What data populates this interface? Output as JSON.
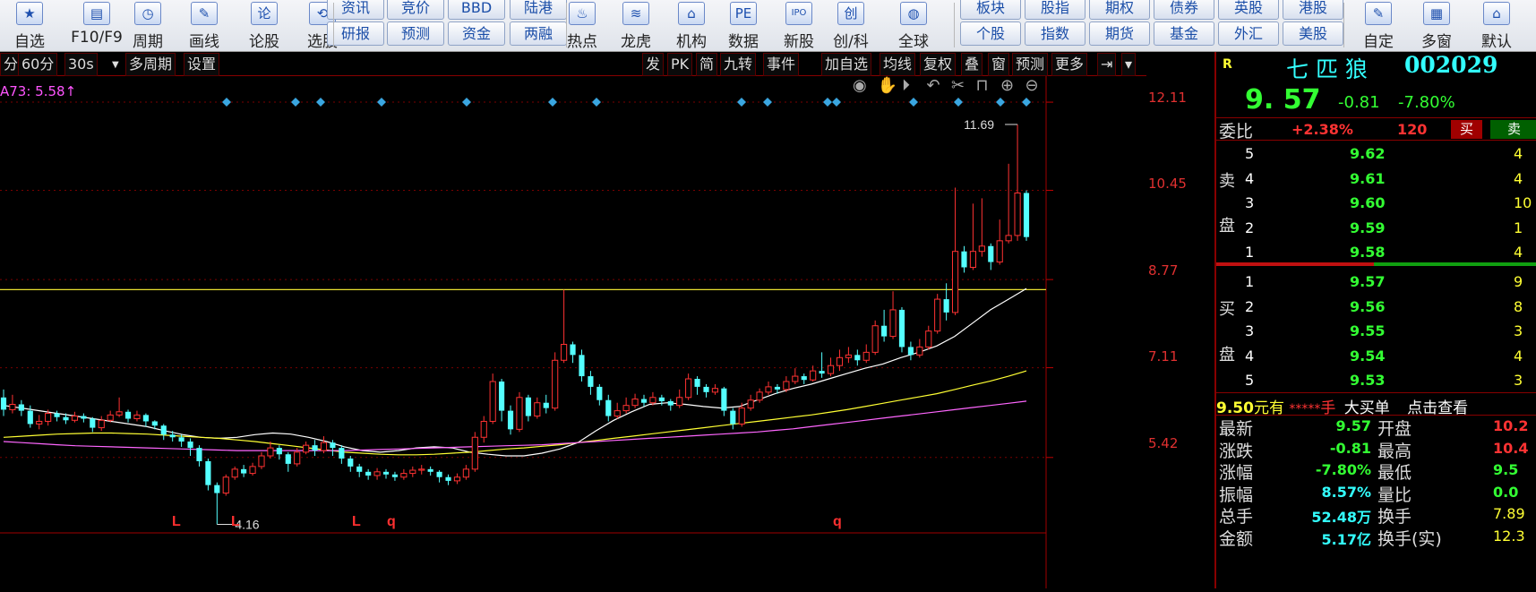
{
  "toolbar": {
    "icon_buttons": [
      {
        "label": "自选",
        "icon": "star-icon",
        "glyph": "★"
      },
      {
        "label": "F10/F9",
        "icon": "f10-icon",
        "glyph": "▤"
      },
      {
        "label": "周期",
        "icon": "clock-icon",
        "glyph": "◷"
      },
      {
        "label": "画线",
        "icon": "pencil-icon",
        "glyph": "✎"
      },
      {
        "label": "论股",
        "icon": "discuss-icon",
        "glyph": "论"
      },
      {
        "label": "选股",
        "icon": "pick-stock-icon",
        "glyph": "⟲"
      }
    ],
    "pills_top": [
      "资讯",
      "竞价",
      "BBD",
      "陆港"
    ],
    "pills_bottom": [
      "研报",
      "预测",
      "资金",
      "两融"
    ],
    "icon_buttons2": [
      {
        "label": "热点",
        "icon": "hot-icon",
        "glyph": "♨"
      },
      {
        "label": "龙虎",
        "icon": "dragon-icon",
        "glyph": "≋"
      },
      {
        "label": "机构",
        "icon": "bank-icon",
        "glyph": "⌂"
      },
      {
        "label": "数据",
        "icon": "pe-icon",
        "glyph": "PE"
      },
      {
        "label": "新股",
        "icon": "ipo-icon",
        "glyph": "IPO"
      },
      {
        "label": "创/科",
        "icon": "chuang-icon",
        "glyph": "创"
      },
      {
        "label": "全球",
        "icon": "globe-icon",
        "glyph": "◍"
      }
    ],
    "pills2_top": [
      "板块",
      "股指",
      "期权",
      "债券",
      "英股",
      "港股"
    ],
    "pills2_bottom": [
      "个股",
      "指数",
      "期货",
      "基金",
      "外汇",
      "美股"
    ],
    "icon_buttons3": [
      {
        "label": "自定",
        "icon": "custom-icon",
        "glyph": "✎"
      },
      {
        "label": "多窗",
        "icon": "multiwindow-icon",
        "glyph": "▦"
      },
      {
        "label": "默认",
        "icon": "home-icon",
        "glyph": "⌂"
      }
    ]
  },
  "chart_toolbar": {
    "left": [
      "分",
      "60分",
      "30s",
      "多周期",
      "设置"
    ],
    "right": [
      "发",
      "PK",
      "简",
      "九转",
      "事件",
      "加自选",
      "均线",
      "复权",
      "叠",
      "窗",
      "预测",
      "更多"
    ]
  },
  "chart": {
    "ma_label": "A73: 5.58↑",
    "y_ticks": [
      "12.11",
      "10.45",
      "8.77",
      "7.11",
      "5.42"
    ],
    "high_label": "11.69",
    "low_label": "4.16",
    "bottom_marks": [
      "L",
      "L",
      "L",
      "q",
      "q"
    ]
  },
  "chart_data": {
    "type": "candlestick",
    "ylim": [
      4.0,
      12.6
    ],
    "y_ticks": [
      12.11,
      10.45,
      8.77,
      7.11,
      5.42
    ],
    "highlight_level": 8.58,
    "high_marker": 11.69,
    "low_marker": 4.16,
    "candles": [
      [
        6.55,
        6.32,
        6.7,
        6.2
      ],
      [
        6.32,
        6.42,
        6.6,
        6.25
      ],
      [
        6.42,
        6.3,
        6.5,
        6.2
      ],
      [
        6.3,
        6.05,
        6.4,
        5.98
      ],
      [
        6.05,
        6.1,
        6.22,
        5.95
      ],
      [
        6.1,
        6.25,
        6.32,
        6.02
      ],
      [
        6.25,
        6.18,
        6.3,
        6.1
      ],
      [
        6.18,
        6.12,
        6.25,
        6.05
      ],
      [
        6.12,
        6.2,
        6.28,
        6.08
      ],
      [
        6.2,
        6.15,
        6.25,
        6.08
      ],
      [
        6.15,
        5.98,
        6.18,
        5.9
      ],
      [
        5.98,
        6.12,
        6.2,
        5.92
      ],
      [
        6.12,
        6.22,
        6.3,
        6.08
      ],
      [
        6.22,
        6.28,
        6.55,
        6.18
      ],
      [
        6.28,
        6.15,
        6.32,
        6.08
      ],
      [
        6.15,
        6.22,
        6.3,
        6.1
      ],
      [
        6.22,
        6.1,
        6.25,
        6.0
      ],
      [
        6.1,
        6.02,
        6.12,
        5.95
      ],
      [
        6.02,
        5.85,
        6.05,
        5.75
      ],
      [
        5.85,
        5.8,
        5.92,
        5.72
      ],
      [
        5.8,
        5.72,
        5.85,
        5.62
      ],
      [
        5.72,
        5.6,
        5.78,
        5.45
      ],
      [
        5.6,
        5.35,
        5.65,
        5.25
      ],
      [
        5.35,
        4.9,
        5.4,
        4.8
      ],
      [
        4.9,
        4.75,
        4.95,
        4.16
      ],
      [
        4.75,
        5.05,
        5.1,
        4.7
      ],
      [
        5.05,
        5.2,
        5.25,
        5.0
      ],
      [
        5.2,
        5.12,
        5.28,
        5.05
      ],
      [
        5.12,
        5.25,
        5.32,
        5.08
      ],
      [
        5.25,
        5.45,
        5.52,
        5.2
      ],
      [
        5.45,
        5.6,
        5.72,
        5.4
      ],
      [
        5.6,
        5.48,
        5.65,
        5.38
      ],
      [
        5.48,
        5.3,
        5.52,
        5.15
      ],
      [
        5.3,
        5.52,
        5.6,
        5.25
      ],
      [
        5.52,
        5.65,
        5.72,
        5.48
      ],
      [
        5.65,
        5.55,
        5.75,
        5.45
      ],
      [
        5.55,
        5.7,
        5.82,
        5.5
      ],
      [
        5.7,
        5.6,
        5.75,
        5.45
      ],
      [
        5.6,
        5.4,
        5.65,
        5.3
      ],
      [
        5.4,
        5.25,
        5.45,
        5.15
      ],
      [
        5.25,
        5.15,
        5.3,
        5.05
      ],
      [
        5.15,
        5.08,
        5.2,
        5.0
      ],
      [
        5.08,
        5.15,
        5.22,
        5.0
      ],
      [
        5.15,
        5.1,
        5.2,
        5.02
      ],
      [
        5.1,
        5.05,
        5.15,
        4.98
      ],
      [
        5.05,
        5.12,
        5.2,
        5.0
      ],
      [
        5.12,
        5.18,
        5.25,
        5.05
      ],
      [
        5.18,
        5.2,
        5.28,
        5.1
      ],
      [
        5.2,
        5.15,
        5.25,
        5.08
      ],
      [
        5.15,
        5.05,
        5.18,
        4.95
      ],
      [
        5.05,
        4.98,
        5.1,
        4.9
      ],
      [
        4.98,
        5.05,
        5.12,
        4.92
      ],
      [
        5.05,
        5.2,
        5.28,
        5.0
      ],
      [
        5.2,
        5.8,
        5.9,
        5.15
      ],
      [
        5.8,
        6.1,
        6.2,
        5.7
      ],
      [
        6.1,
        6.85,
        7.0,
        6.05
      ],
      [
        6.85,
        6.3,
        6.9,
        6.1
      ],
      [
        6.3,
        5.95,
        6.4,
        5.85
      ],
      [
        5.95,
        6.55,
        6.65,
        5.9
      ],
      [
        6.55,
        6.2,
        6.6,
        6.1
      ],
      [
        6.2,
        6.45,
        6.55,
        6.15
      ],
      [
        6.45,
        6.35,
        6.6,
        6.25
      ],
      [
        6.35,
        7.25,
        7.4,
        6.3
      ],
      [
        7.25,
        7.55,
        8.58,
        7.2
      ],
      [
        7.55,
        7.35,
        7.6,
        7.2
      ],
      [
        7.35,
        6.95,
        7.45,
        6.85
      ],
      [
        6.95,
        6.75,
        7.05,
        6.6
      ],
      [
        6.75,
        6.5,
        6.8,
        6.4
      ],
      [
        6.5,
        6.2,
        6.6,
        6.1
      ],
      [
        6.2,
        6.3,
        6.45,
        6.15
      ],
      [
        6.3,
        6.4,
        6.55,
        6.25
      ],
      [
        6.4,
        6.52,
        6.62,
        6.35
      ],
      [
        6.52,
        6.45,
        6.6,
        6.38
      ],
      [
        6.45,
        6.55,
        6.65,
        6.4
      ],
      [
        6.55,
        6.48,
        6.6,
        6.4
      ],
      [
        6.48,
        6.4,
        6.52,
        6.3
      ],
      [
        6.4,
        6.55,
        6.7,
        6.35
      ],
      [
        6.55,
        6.9,
        7.0,
        6.5
      ],
      [
        6.9,
        6.75,
        6.95,
        6.6
      ],
      [
        6.75,
        6.65,
        6.8,
        6.55
      ],
      [
        6.65,
        6.72,
        6.8,
        6.6
      ],
      [
        6.72,
        6.3,
        6.75,
        6.2
      ],
      [
        6.3,
        6.05,
        6.35,
        5.95
      ],
      [
        6.05,
        6.35,
        6.45,
        6.0
      ],
      [
        6.35,
        6.5,
        6.6,
        6.3
      ],
      [
        6.5,
        6.65,
        6.72,
        6.45
      ],
      [
        6.65,
        6.75,
        6.85,
        6.6
      ],
      [
        6.75,
        6.7,
        6.8,
        6.62
      ],
      [
        6.7,
        6.85,
        6.95,
        6.65
      ],
      [
        6.85,
        6.95,
        7.1,
        6.8
      ],
      [
        6.95,
        6.88,
        7.0,
        6.8
      ],
      [
        6.88,
        7.05,
        7.15,
        6.85
      ],
      [
        7.05,
        7.0,
        7.4,
        6.92
      ],
      [
        7.0,
        7.15,
        7.3,
        6.95
      ],
      [
        7.15,
        7.3,
        7.45,
        7.05
      ],
      [
        7.3,
        7.35,
        7.5,
        7.2
      ],
      [
        7.35,
        7.25,
        7.45,
        7.15
      ],
      [
        7.25,
        7.4,
        7.55,
        7.2
      ],
      [
        7.4,
        7.9,
        8.0,
        7.35
      ],
      [
        7.9,
        7.7,
        8.2,
        7.6
      ],
      [
        7.7,
        8.2,
        8.55,
        7.65
      ],
      [
        8.2,
        7.5,
        8.25,
        7.4
      ],
      [
        7.5,
        7.35,
        7.6,
        7.25
      ],
      [
        7.35,
        7.5,
        7.65,
        7.3
      ],
      [
        7.5,
        7.8,
        7.9,
        7.45
      ],
      [
        7.8,
        8.4,
        8.5,
        7.75
      ],
      [
        8.4,
        8.15,
        8.7,
        8.0
      ],
      [
        8.15,
        9.3,
        10.5,
        8.1
      ],
      [
        9.3,
        9.0,
        9.4,
        8.9
      ],
      [
        9.0,
        9.3,
        10.2,
        8.95
      ],
      [
        9.3,
        9.4,
        10.3,
        9.2
      ],
      [
        9.4,
        9.1,
        9.45,
        8.95
      ],
      [
        9.1,
        9.5,
        9.9,
        9.05
      ],
      [
        9.5,
        9.6,
        10.95,
        9.45
      ],
      [
        9.6,
        10.4,
        11.69,
        9.5
      ],
      [
        10.4,
        9.57,
        10.45,
        9.5
      ]
    ],
    "ma_lines": [
      {
        "color": "#ffffff",
        "values": [
          6.4,
          6.35,
          6.3,
          6.25,
          6.2,
          6.15,
          6.1,
          6.05,
          6.0,
          5.92,
          5.85,
          5.8,
          5.78,
          5.8,
          5.85,
          5.88,
          5.86,
          5.8,
          5.72,
          5.62,
          5.55,
          5.52,
          5.55,
          5.6,
          5.62,
          5.6,
          5.52,
          5.48,
          5.45,
          5.45,
          5.5,
          5.58,
          5.7,
          5.92,
          6.12,
          6.28,
          6.42,
          6.45,
          6.42,
          6.38,
          6.35,
          6.38,
          6.5,
          6.62,
          6.72,
          6.8,
          6.9,
          7.0,
          7.1,
          7.18,
          7.3,
          7.4,
          7.52,
          7.7,
          7.95,
          8.2,
          8.4,
          8.6
        ]
      },
      {
        "color": "#ffff33",
        "values": [
          5.8,
          5.82,
          5.84,
          5.86,
          5.87,
          5.88,
          5.88,
          5.87,
          5.86,
          5.84,
          5.82,
          5.8,
          5.78,
          5.75,
          5.72,
          5.68,
          5.64,
          5.6,
          5.56,
          5.52,
          5.5,
          5.48,
          5.47,
          5.47,
          5.48,
          5.5,
          5.52,
          5.55,
          5.58,
          5.6,
          5.63,
          5.66,
          5.7,
          5.74,
          5.78,
          5.82,
          5.86,
          5.9,
          5.94,
          5.98,
          6.02,
          6.06,
          6.1,
          6.14,
          6.18,
          6.22,
          6.27,
          6.32,
          6.38,
          6.44,
          6.5,
          6.56,
          6.62,
          6.7,
          6.78,
          6.86,
          6.95,
          7.05
        ]
      },
      {
        "color": "#ff66ff",
        "values": [
          5.72,
          5.7,
          5.68,
          5.66,
          5.64,
          5.63,
          5.62,
          5.61,
          5.6,
          5.59,
          5.58,
          5.57,
          5.56,
          5.55,
          5.55,
          5.55,
          5.55,
          5.55,
          5.55,
          5.55,
          5.56,
          5.57,
          5.58,
          5.59,
          5.6,
          5.61,
          5.62,
          5.63,
          5.64,
          5.65,
          5.66,
          5.68,
          5.7,
          5.72,
          5.74,
          5.76,
          5.78,
          5.8,
          5.82,
          5.84,
          5.86,
          5.88,
          5.9,
          5.93,
          5.96,
          6.0,
          6.04,
          6.08,
          6.12,
          6.16,
          6.2,
          6.24,
          6.28,
          6.32,
          6.36,
          6.4,
          6.44,
          6.48
        ]
      }
    ]
  },
  "stock": {
    "badge": "R",
    "name": "七 匹 狼",
    "code": "002029",
    "price": "9. 57",
    "change": "-0.81",
    "change_pct": "-7.80%"
  },
  "quote": {
    "weibi_label": "委比",
    "weibi_value": "+2.38%",
    "weibi_diff": "120",
    "buy_label": "买",
    "sell_label": "卖",
    "sell_side": [
      "卖",
      "盘"
    ],
    "buy_side": [
      "买",
      "盘"
    ],
    "asks": [
      {
        "level": "5",
        "price": "9.62",
        "vol": "4"
      },
      {
        "level": "4",
        "price": "9.61",
        "vol": "4"
      },
      {
        "level": "3",
        "price": "9.60",
        "vol": "10"
      },
      {
        "level": "2",
        "price": "9.59",
        "vol": "1"
      },
      {
        "level": "1",
        "price": "9.58",
        "vol": "4"
      }
    ],
    "bids": [
      {
        "level": "1",
        "price": "9.57",
        "vol": "9"
      },
      {
        "level": "2",
        "price": "9.56",
        "vol": "8"
      },
      {
        "level": "3",
        "price": "9.55",
        "vol": "3"
      },
      {
        "level": "4",
        "price": "9.54",
        "vol": "4"
      },
      {
        "level": "5",
        "price": "9.53",
        "vol": "3"
      }
    ],
    "big_order": {
      "price": "9.50",
      "unit": "元有",
      "stars": "*****",
      "shou": "手",
      "tag": "大买单",
      "link": "点击查看"
    },
    "stats": [
      {
        "l1": "最新",
        "v1": "9.57",
        "c1": "g",
        "l2": "开盘",
        "v2": "10.2",
        "c2": "r"
      },
      {
        "l1": "涨跌",
        "v1": "-0.81",
        "c1": "g",
        "l2": "最高",
        "v2": "10.4",
        "c2": "r"
      },
      {
        "l1": "涨幅",
        "v1": "-7.80%",
        "c1": "g",
        "l2": "最低",
        "v2": "9.5",
        "c2": "g"
      },
      {
        "l1": "振幅",
        "v1": "8.57%",
        "c1": "c",
        "l2": "量比",
        "v2": "0.0",
        "c2": "g"
      },
      {
        "l1": "总手",
        "v1": "52.48万",
        "c1": "c",
        "l2": "换手",
        "v2": "7.89",
        "c2": "y"
      },
      {
        "l1": "金额",
        "v1": "5.17亿",
        "c1": "c",
        "l2": "换手(实)",
        "v2": "12.3",
        "c2": "y"
      }
    ]
  }
}
